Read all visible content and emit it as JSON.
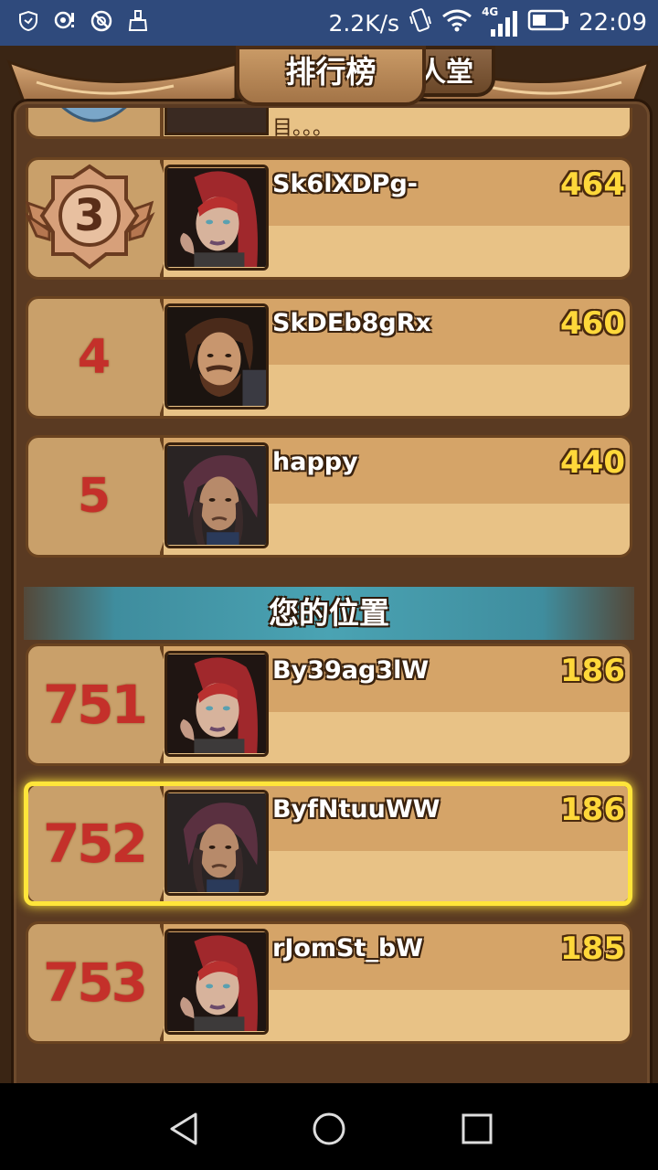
{
  "status_bar": {
    "speed": "2.2K/s",
    "network": "4G",
    "time": "22:09"
  },
  "header": {
    "title": "排行榜",
    "other_tab": "人堂"
  },
  "top_partial": {
    "name_fragment": "目。。。"
  },
  "leaderboard": [
    {
      "rank": "3",
      "name": "Sk6lXDPg-",
      "score": "464",
      "avatar": "red-hair-woman"
    },
    {
      "rank": "4",
      "name": "SkDEb8gRx",
      "score": "460",
      "avatar": "bearded-man"
    },
    {
      "rank": "5",
      "name": "happy",
      "score": "440",
      "avatar": "hooded-man"
    }
  ],
  "divider_label": "您的位置",
  "my_position": [
    {
      "rank": "751",
      "name": "By39ag3lW",
      "score": "186",
      "avatar": "red-hair-woman"
    },
    {
      "rank": "752",
      "name": "ByfNtuuWW",
      "score": "186",
      "avatar": "hooded-man",
      "is_self": true
    },
    {
      "rank": "753",
      "name": "rJomSt_bW",
      "score": "185",
      "avatar": "red-hair-woman"
    }
  ],
  "colors": {
    "status_bar": "#2f4a7c",
    "rank_text": "#c4302a",
    "score_text": "#ffd83a",
    "highlight": "#ffe53a"
  }
}
